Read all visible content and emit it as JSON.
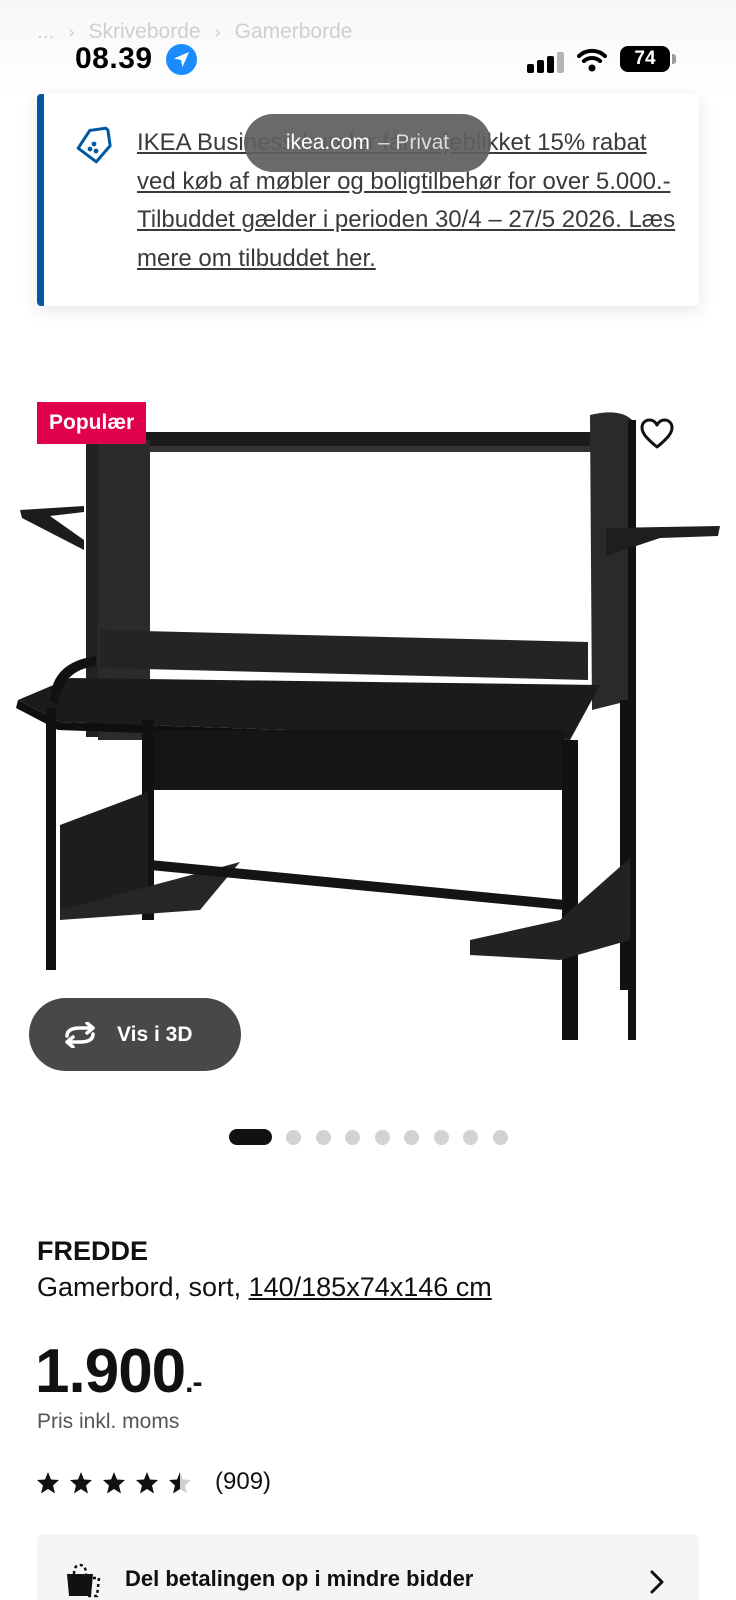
{
  "breadcrumb": {
    "ellipsis": "...",
    "items": [
      "Skriveborde",
      "Gamerborde"
    ]
  },
  "status_bar": {
    "time": "08.39",
    "battery": "74"
  },
  "browser": {
    "domain": "ikea.com",
    "mode": "– Privat"
  },
  "promo": {
    "icon": "price-tag-icon",
    "text": "IKEA Business-kunder får i øjeblikket 15% rabat ved køb af møbler og boligtilbehør for over 5.000.- Tilbuddet gælder i perioden 30/4 – 27/5 2026. Læs mere om tilbuddet her."
  },
  "product": {
    "badge": "Populær",
    "view_3d_label": "Vis i 3D",
    "image_count": 9,
    "active_image": 1,
    "name": "FREDDE",
    "description": "Gamerbord, sort,",
    "dimensions": "140/185x74x146 cm",
    "price": "1.900",
    "price_suffix": ".-",
    "vat_note": "Pris inkl. moms",
    "rating_value": 4.5,
    "rating_max": 5,
    "rating_count": "(909)"
  },
  "payment": {
    "label": "Del betalingen op i mindre bidder",
    "icon": "shopping-bag-icon"
  },
  "colors": {
    "accent_blue": "#0058a3",
    "badge_red": "#e0004d",
    "pill_gray": "#484848"
  }
}
